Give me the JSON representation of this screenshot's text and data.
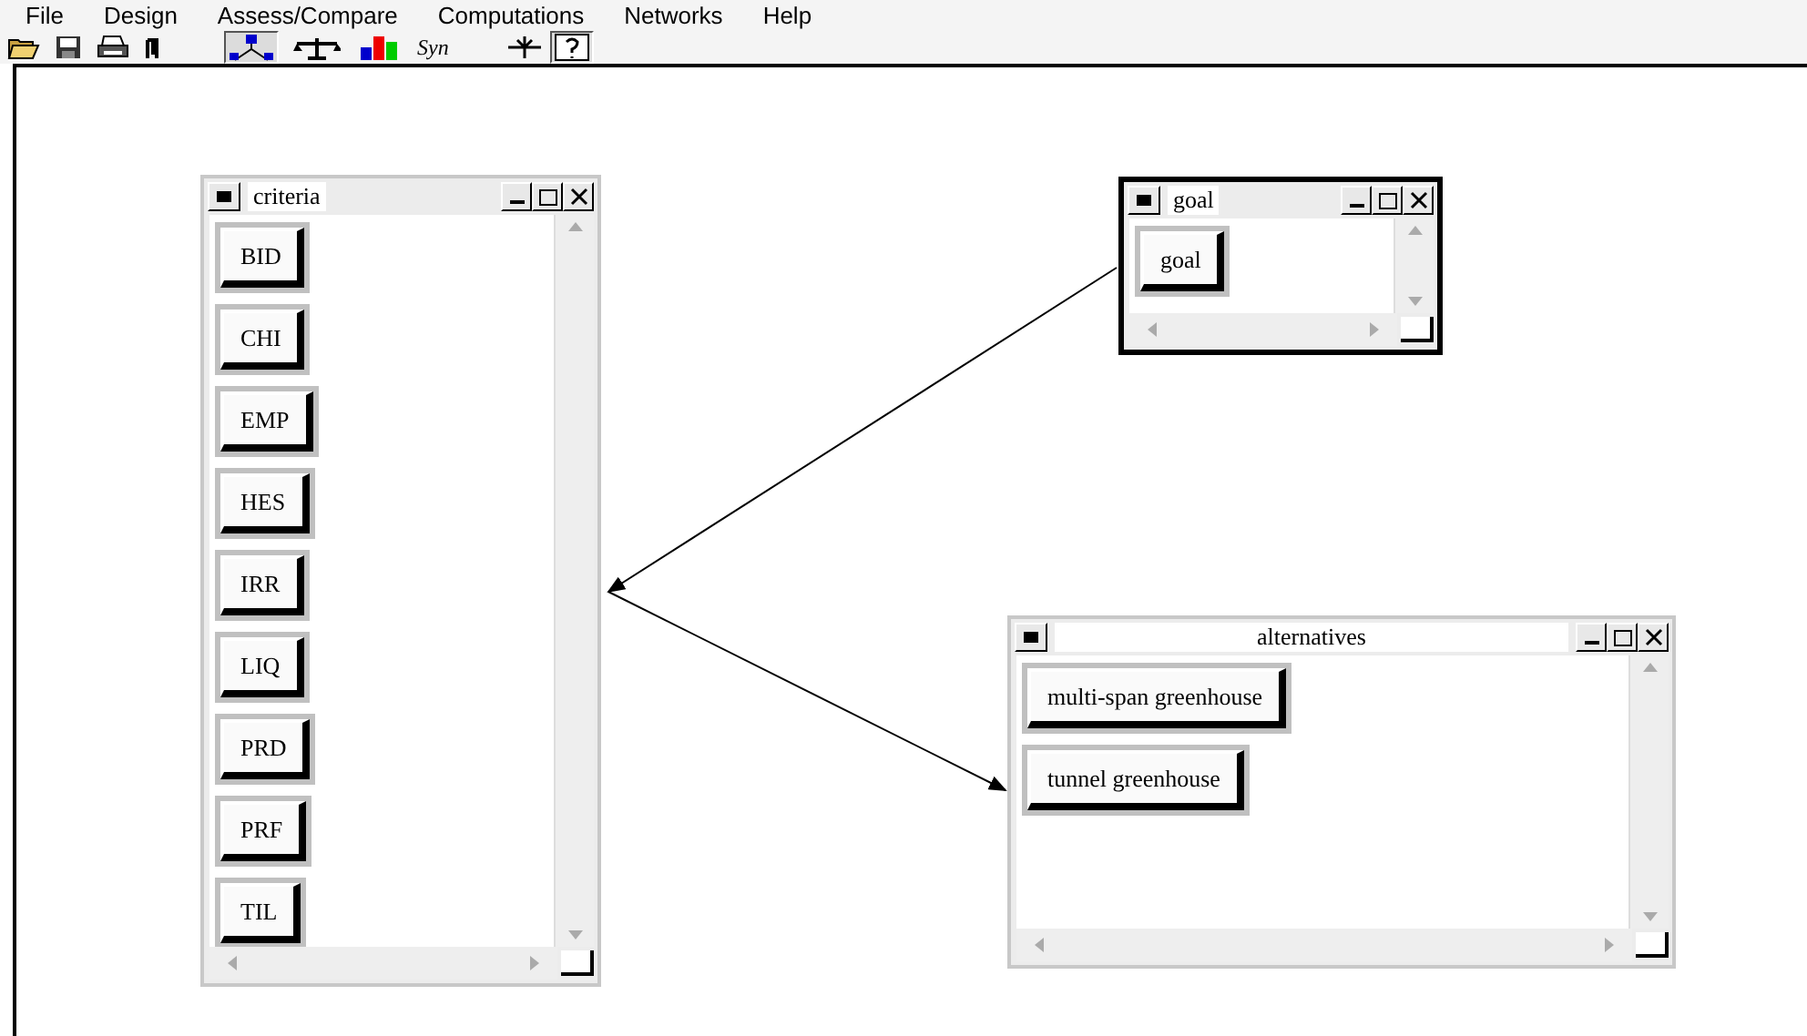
{
  "menu": [
    "File",
    "Design",
    "Assess/Compare",
    "Computations",
    "Networks",
    "Help"
  ],
  "toolbar": [
    {
      "kind": "icon",
      "selected": false
    },
    {
      "kind": "icon",
      "selected": false
    },
    {
      "kind": "icon",
      "selected": false
    },
    {
      "kind": "icon",
      "selected": false
    },
    {
      "kind": "icon",
      "selected": true
    },
    {
      "kind": "icon",
      "selected": false
    },
    {
      "kind": "icon",
      "selected": false
    },
    {
      "kind": "text",
      "label": "Syn",
      "selected": false
    },
    {
      "kind": "icon",
      "selected": false
    },
    {
      "kind": "icon",
      "selected": true
    }
  ],
  "windows": [
    {
      "title": "criteria",
      "active": false,
      "items": [
        "BID",
        "CHI",
        "EMP",
        "HES",
        "IRR",
        "LIQ",
        "PRD",
        "PRF",
        "TIL"
      ]
    },
    {
      "title": "goal",
      "active": true,
      "items": [
        "goal"
      ]
    },
    {
      "title": "alternatives",
      "active": false,
      "items": [
        "multi-span greenhouse",
        "tunnel greenhouse"
      ]
    }
  ]
}
